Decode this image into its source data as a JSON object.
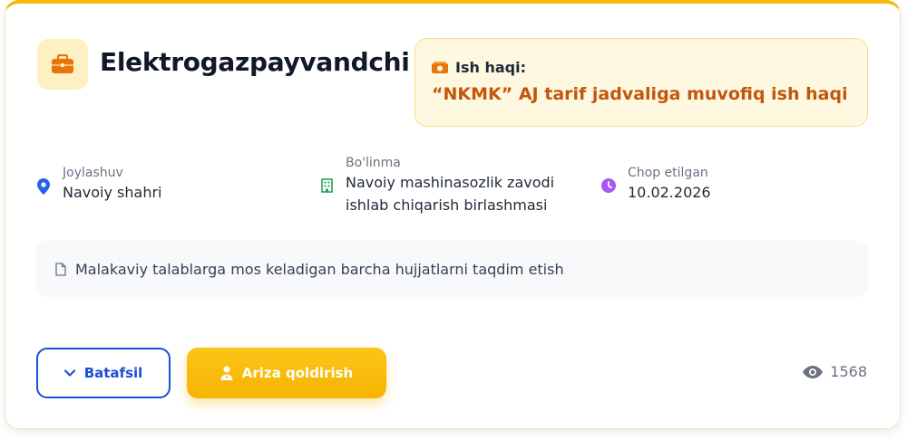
{
  "job": {
    "title": "Elektrogazpayvandchi",
    "icon": "briefcase-icon"
  },
  "salary": {
    "label": "Ish haqi:",
    "value": "“NKMK” AJ tarif jadvaliga muvofiq ish haqi",
    "icon": "money-icon"
  },
  "meta": {
    "location": {
      "label": "Joylashuv",
      "value": "Navoiy shahri",
      "icon": "location-pin-icon"
    },
    "division": {
      "label": "Bo'linma",
      "value_line1": "Navoiy mashinasozlik zavodi",
      "value_line2": "ishlab chiqarish birlashmasi",
      "icon": "building-icon"
    },
    "published": {
      "label": "Chop etilgan",
      "value": "10.02.2026",
      "icon": "clock-icon"
    }
  },
  "note": {
    "text": "Malakaviy talablarga mos keladigan barcha hujjatlarni taqdim etish",
    "icon": "document-icon"
  },
  "actions": {
    "details_label": "Batafsil",
    "apply_label": "Ariza qoldirish"
  },
  "views": {
    "count": "1568",
    "icon": "eye-icon"
  },
  "colors": {
    "accent": "#f6b70d",
    "salary_text": "#c2570c",
    "primary_blue": "#1d4ed8",
    "pin_blue": "#2563eb",
    "building_green": "#22a35a",
    "clock_purple": "#a855f7"
  }
}
